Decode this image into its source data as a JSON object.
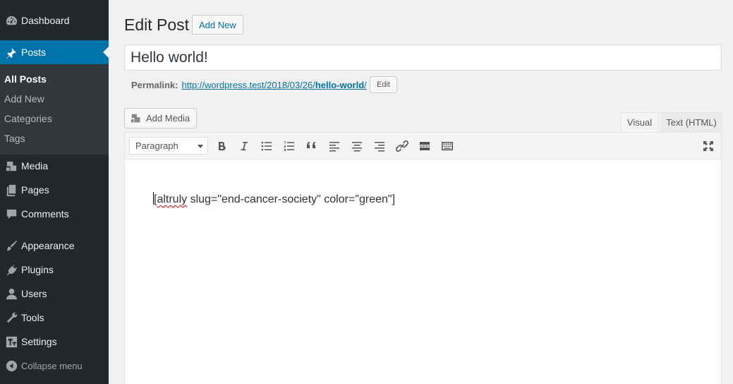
{
  "sidebar": {
    "items": [
      {
        "label": "Dashboard",
        "icon": "dashboard-icon"
      },
      {
        "label": "Posts",
        "icon": "pin-icon",
        "active": true
      },
      {
        "label": "Media",
        "icon": "media-icon"
      },
      {
        "label": "Pages",
        "icon": "pages-icon"
      },
      {
        "label": "Comments",
        "icon": "comments-icon"
      },
      {
        "label": "Appearance",
        "icon": "brush-icon"
      },
      {
        "label": "Plugins",
        "icon": "plugin-icon"
      },
      {
        "label": "Users",
        "icon": "users-icon"
      },
      {
        "label": "Tools",
        "icon": "wrench-icon"
      },
      {
        "label": "Settings",
        "icon": "settings-icon"
      }
    ],
    "submenu": [
      "All Posts",
      "Add New",
      "Categories",
      "Tags"
    ],
    "collapse_label": "Collapse menu"
  },
  "header": {
    "title": "Edit Post",
    "add_new_label": "Add New"
  },
  "post": {
    "title": "Hello world!",
    "permalink_label": "Permalink:",
    "permalink_base": "http://wordpress.test/2018/03/26/",
    "permalink_slug": "hello-world",
    "permalink_trailing": "/",
    "edit_label": "Edit"
  },
  "editor": {
    "add_media_label": "Add Media",
    "tabs": {
      "visual": "Visual",
      "text": "Text (HTML)"
    },
    "format_select": "Paragraph",
    "content_misspelled": "altruly",
    "content_open": "[",
    "content_rest": " slug=\"end-cancer-society\" color=\"green\"]"
  },
  "colors": {
    "sidebar_bg": "#23282d",
    "active_bg": "#0073aa",
    "link": "#0073aa"
  }
}
